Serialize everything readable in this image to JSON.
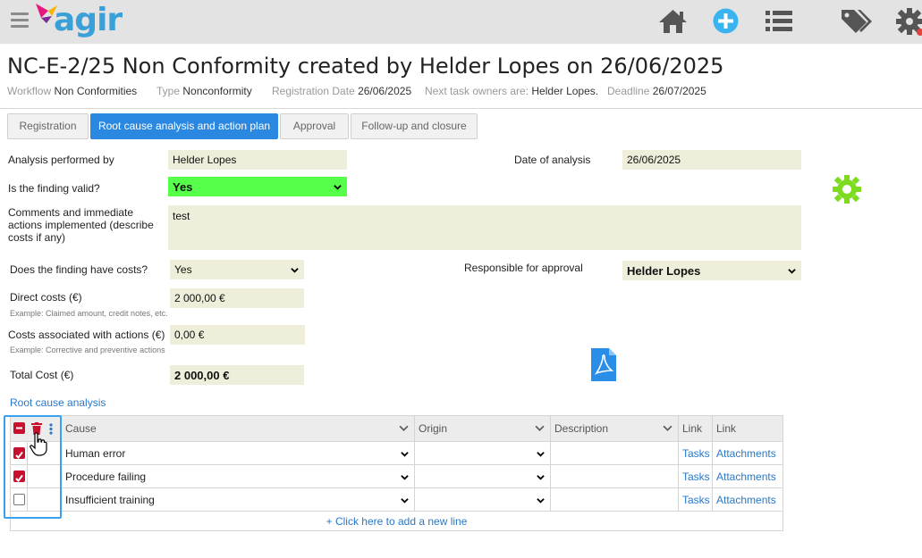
{
  "app": {
    "logo_text": "agir",
    "colors": {
      "accent": "#2b88e0",
      "logo": "#3aa0d8",
      "green_field": "#55ff4a",
      "field_bg": "#efeedb",
      "gear_green": "#7ddc1f",
      "checkbox_red": "#c8102e",
      "pdf_blue": "#2a8ee8"
    },
    "icons": [
      "menu-icon",
      "home-icon",
      "add-circle-icon",
      "list-icon",
      "tags-icon",
      "settings-icon"
    ]
  },
  "header": {
    "title": "NC-E-2/25 Non Conformity created by Helder Lopes on 26/06/2025",
    "meta": {
      "workflow_label": "Workflow",
      "workflow_value": "Non Conformities",
      "type_label": "Type",
      "type_value": "Nonconformity",
      "regdate_label": "Registration Date",
      "regdate_value": "26/06/2025",
      "owners_label": "Next task owners are:",
      "owners_value": "Helder Lopes.",
      "deadline_label": "Deadline",
      "deadline_value": "26/07/2025"
    }
  },
  "tabs": [
    {
      "label": "Registration",
      "active": false
    },
    {
      "label": "Root cause analysis and action plan",
      "active": true
    },
    {
      "label": "Approval",
      "active": false
    },
    {
      "label": "Follow-up and closure",
      "active": false
    }
  ],
  "form": {
    "analysis_by_label": "Analysis performed by",
    "analysis_by_value": "Helder Lopes",
    "date_label": "Date of analysis",
    "date_value": "26/06/2025",
    "valid_label": "Is the finding valid?",
    "valid_value": "Yes",
    "comments_label": "Comments and immediate actions implemented (describe costs if any)",
    "comments_value": "test",
    "costs_label": "Does the finding have costs?",
    "costs_value": "Yes",
    "approval_label": "Responsible for approval",
    "approval_value": "Helder Lopes",
    "direct_label": "Direct costs (€)",
    "direct_value": "2 000,00 €",
    "direct_hint": "Example: Claimed amount, credit notes, etc.",
    "actions_label": "Costs associated with actions (€)",
    "actions_value": "0,00 €",
    "actions_hint": "Example: Corrective and preventive actions",
    "total_label": "Total Cost (€)",
    "total_value": "2 000,00 €",
    "root_cause_link": "Root cause analysis"
  },
  "table": {
    "headers": {
      "cause": "Cause",
      "origin": "Origin",
      "description": "Description",
      "link1": "Link",
      "link2": "Link"
    },
    "rows": [
      {
        "checked": true,
        "cause": "Human error",
        "origin": "",
        "description": "",
        "tasks": "Tasks",
        "attachments": "Attachments"
      },
      {
        "checked": true,
        "cause": "Procedure failing",
        "origin": "",
        "description": "",
        "tasks": "Tasks",
        "attachments": "Attachments"
      },
      {
        "checked": false,
        "cause": "Insufficient training",
        "origin": "",
        "description": "",
        "tasks": "Tasks",
        "attachments": "Attachments"
      }
    ],
    "add_line": "+ Click here to add a new line"
  }
}
